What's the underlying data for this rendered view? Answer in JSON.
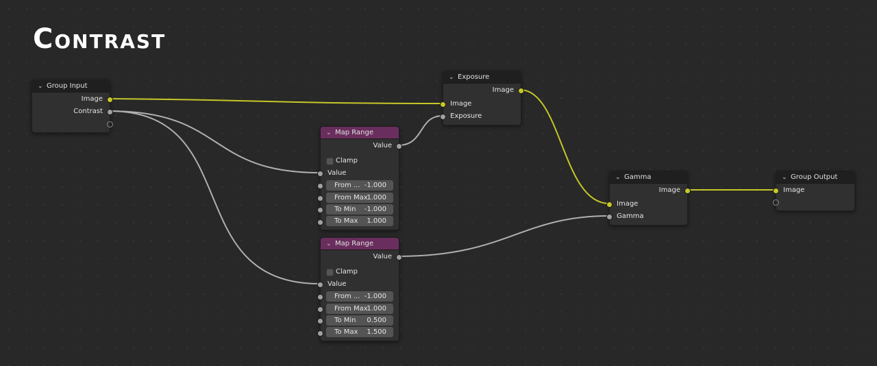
{
  "title": "Contrast",
  "colors": {
    "image_link": "#c7c729",
    "value_link": "#a1a1a1",
    "map_range_header": "#6a2e5e"
  },
  "nodes": {
    "group_input": {
      "title": "Group Input",
      "outputs": [
        "Image",
        "Contrast"
      ]
    },
    "exposure": {
      "title": "Exposure",
      "output": "Image",
      "inputs": [
        "Image",
        "Exposure"
      ]
    },
    "map_range_1": {
      "title": "Map Range",
      "output": "Value",
      "clamp_label": "Clamp",
      "input": "Value",
      "fields": [
        {
          "label": "From ...",
          "value": "-1.000"
        },
        {
          "label": "From Max",
          "value": "1.000"
        },
        {
          "label": "To Min",
          "value": "-1.000"
        },
        {
          "label": "To Max",
          "value": "1.000"
        }
      ]
    },
    "map_range_2": {
      "title": "Map Range",
      "output": "Value",
      "clamp_label": "Clamp",
      "input": "Value",
      "fields": [
        {
          "label": "From ...",
          "value": "-1.000"
        },
        {
          "label": "From Max",
          "value": "1.000"
        },
        {
          "label": "To Min",
          "value": "0.500"
        },
        {
          "label": "To Max",
          "value": "1.500"
        }
      ]
    },
    "gamma": {
      "title": "Gamma",
      "output": "Image",
      "inputs": [
        "Image",
        "Gamma"
      ]
    },
    "group_output": {
      "title": "Group Output",
      "input": "Image"
    }
  }
}
